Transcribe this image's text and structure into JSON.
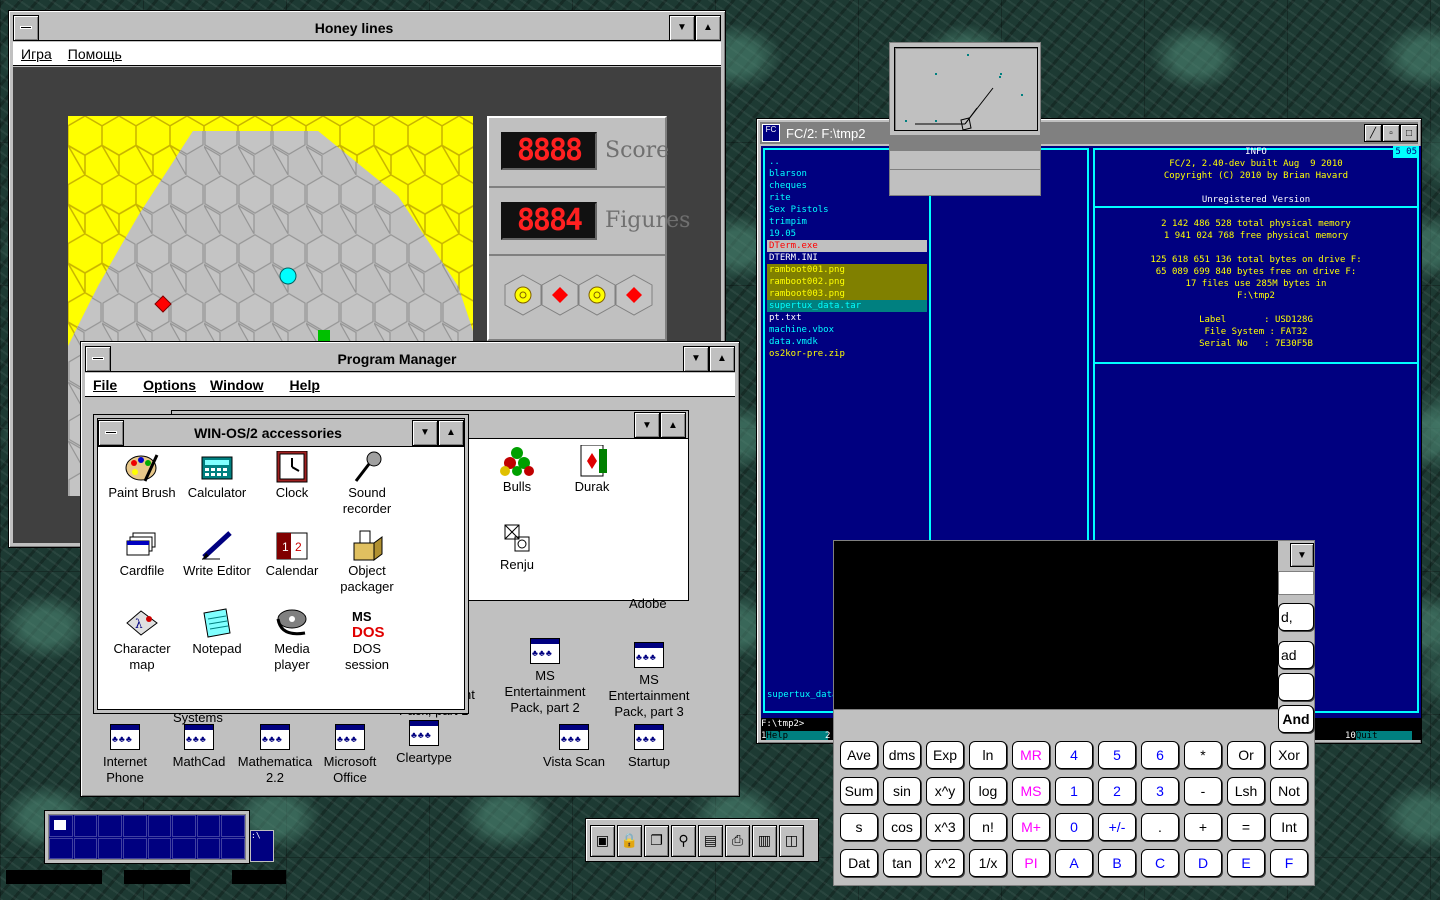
{
  "honey": {
    "title": "Honey lines",
    "menu": [
      "Игра",
      "Помощь"
    ],
    "score_label": "Score",
    "figures_label": "Figures",
    "score_digits": "8888",
    "figures_digits": "8884"
  },
  "program_manager": {
    "title": "Program Manager",
    "menu": [
      "File",
      "Options",
      "Window",
      "Help"
    ],
    "group_back_items": [
      {
        "label": "Bulls",
        "icon": "bulls-icon"
      },
      {
        "label": "Durak",
        "icon": "durak-card-icon"
      },
      {
        "label": "Renju",
        "icon": "renju-icon"
      }
    ],
    "group_icons": [
      {
        "label": "MS\nEntertainment\nPack, part 2"
      },
      {
        "label": "MS\nEntertainment\nPack, part 3"
      },
      {
        "label": "Internet\nPhone"
      },
      {
        "label": "MathCad"
      },
      {
        "label": "Mathematica\n2.2"
      },
      {
        "label": "Microsoft\nOffice"
      },
      {
        "label": "Cleartype"
      },
      {
        "label": "Vista Scan"
      },
      {
        "label": "Startup"
      }
    ],
    "partial_labels": {
      "systems": "Systems",
      "pack1": "Pack, part 1",
      "nt": "nt",
      "adobe": "Adobe"
    }
  },
  "accessories": {
    "title": "WIN-OS/2 accessories",
    "items": [
      {
        "label": "Paint Brush",
        "icon": "paint-palette-icon"
      },
      {
        "label": "Calculator",
        "icon": "calculator-icon"
      },
      {
        "label": "Clock",
        "icon": "clock-icon"
      },
      {
        "label": "Sound\nrecorder",
        "icon": "microphone-icon"
      },
      {
        "label": "Cardfile",
        "icon": "cardfile-icon"
      },
      {
        "label": "Write Editor",
        "icon": "pen-icon"
      },
      {
        "label": "Calendar",
        "icon": "calendar-icon"
      },
      {
        "label": "Object\npackager",
        "icon": "package-icon"
      },
      {
        "label": "Character\nmap",
        "icon": "character-map-icon"
      },
      {
        "label": "Notepad",
        "icon": "notepad-icon"
      },
      {
        "label": "Media\nplayer",
        "icon": "film-reel-icon"
      },
      {
        "label": "DOS\nsession",
        "icon": "ms-dos-icon"
      }
    ]
  },
  "fc2": {
    "title": "FC/2: F:\\tmp2",
    "files": [
      {
        "name": "..",
        "color": "#00ffff",
        "bg": ""
      },
      {
        "name": "blarson",
        "color": "#00ffff",
        "bg": ""
      },
      {
        "name": "cheques",
        "color": "#00ffff",
        "bg": ""
      },
      {
        "name": "rite",
        "color": "#00ffff",
        "bg": ""
      },
      {
        "name": "Sex Pistols",
        "color": "#00ffff",
        "bg": ""
      },
      {
        "name": "trimpim",
        "color": "#00ffff",
        "bg": ""
      },
      {
        "name": "19.05",
        "color": "#00ffff",
        "bg": ""
      },
      {
        "name": "DTerm.exe",
        "color": "#ff0000",
        "bg": "#c0c0c0"
      },
      {
        "name": "DTERM.INI",
        "color": "#ffffff",
        "bg": ""
      },
      {
        "name": "ramboot001.png",
        "color": "#ffff00",
        "bg": "#808000"
      },
      {
        "name": "ramboot002.png",
        "color": "#ffff00",
        "bg": "#808000"
      },
      {
        "name": "ramboot003.png",
        "color": "#ffff00",
        "bg": "#808000"
      },
      {
        "name": "supertux_data.tar",
        "color": "#00ffff",
        "bg": "#008080"
      },
      {
        "name": "pt.txt",
        "color": "#ffffff",
        "bg": ""
      },
      {
        "name": "machine.vbox",
        "color": "#00ffff",
        "bg": ""
      },
      {
        "name": "data.vmdk",
        "color": "#00ffff",
        "bg": ""
      },
      {
        "name": "os2kor-pre.zip",
        "color": "#ffff00",
        "bg": ""
      }
    ],
    "info_header": "INFO",
    "info_lines": [
      "FC/2, 2.40-dev built Aug  9 2010",
      "Copyright (C) 2010 by Brian Havard",
      "",
      "Unregistered Version",
      "",
      "2 142 486 528 total physical memory",
      "1 941 024 768 free physical memory",
      "",
      "125 618 651 136 total bytes on drive F:",
      "65 089 699 840 bytes free on drive F:",
      "17 files use 285M bytes in",
      "F:\\tmp2",
      "",
      "Label       : USD128G",
      "File System : FAT32",
      "Serial No   : 7E30F5B"
    ],
    "status_file": "supertux_data.",
    "prompt": "F:\\tmp2>",
    "fkeys": [
      "1Help",
      "2",
      "10Quit"
    ],
    "clock_time": "5 05"
  },
  "calc": {
    "rows": [
      [
        "Ave",
        "dms",
        "Exp",
        "ln",
        "MR",
        "4",
        "5",
        "6",
        "*",
        "Or",
        "Xor"
      ],
      [
        "Sum",
        "sin",
        "x^y",
        "log",
        "MS",
        "1",
        "2",
        "3",
        "-",
        "Lsh",
        "Not"
      ],
      [
        "s",
        "cos",
        "x^3",
        "n!",
        "M+",
        "0",
        "+/-",
        ".",
        "+",
        "=",
        "Int"
      ],
      [
        "Dat",
        "tan",
        "x^2",
        "1/x",
        "PI",
        "A",
        "B",
        "C",
        "D",
        "E",
        "F"
      ]
    ],
    "partial": {
      "and": "And",
      "d": "d,",
      "ad": "ad"
    },
    "colors": {
      "memory": "#ff00ff",
      "digits": "#0000ff",
      "ops": "#000000"
    }
  },
  "taskbar": {
    "tools": [
      "monitor-icon",
      "lock-icon",
      "windows-icon",
      "magnifier-icon",
      "save-icon",
      "printer-icon",
      "folder-icon",
      "drive-icon"
    ]
  }
}
